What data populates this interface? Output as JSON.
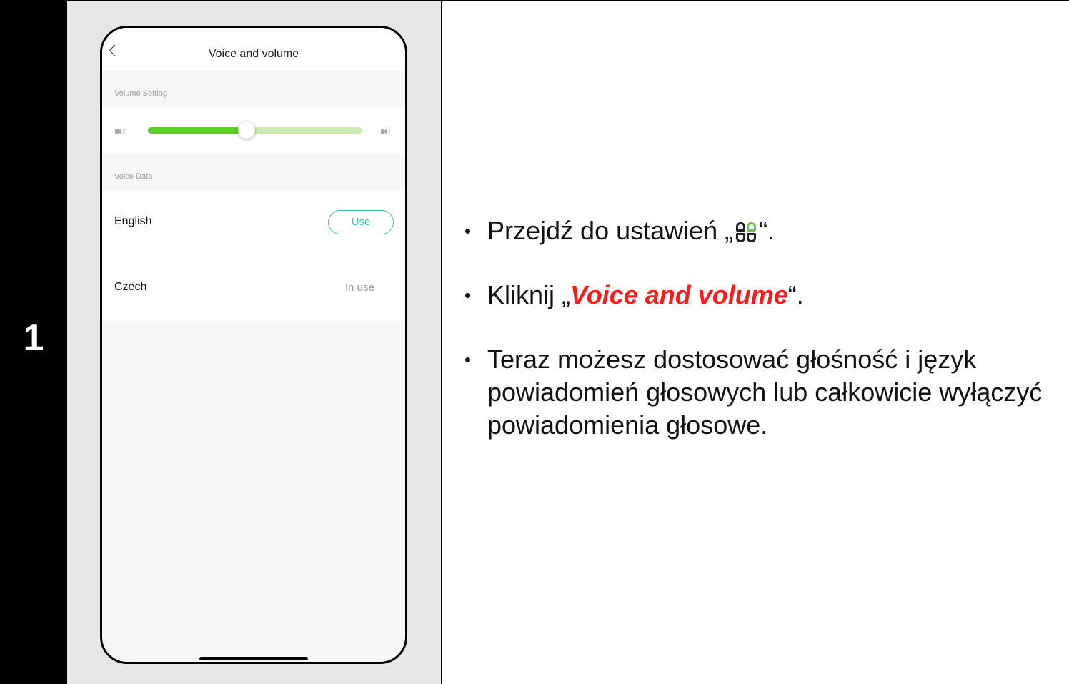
{
  "step": {
    "number": "1"
  },
  "phone": {
    "title": "Voice and volume",
    "volume_section_label": "Volume Setting",
    "volume_level": 0.46,
    "voice_section_label": "Voice Data",
    "languages": [
      {
        "name": "English",
        "action": "Use"
      },
      {
        "name": "Czech",
        "status": "In use"
      }
    ],
    "colors": {
      "accent": "#5fcf2a",
      "track": "#c8ecb2",
      "button": "#33c4a8"
    }
  },
  "instructions": {
    "item1_before": "Przejdź do ustawień „",
    "item1_icon": "grid-settings-icon",
    "item1_after": "“.",
    "item2_before": "Kliknij „",
    "item2_emph": "Voice and volume",
    "item2_after": "“.",
    "item3": "Teraz możesz dostosować głośność i język powiadomień głosowych lub całkowicie wyłączyć powiadomienia głosowe."
  }
}
